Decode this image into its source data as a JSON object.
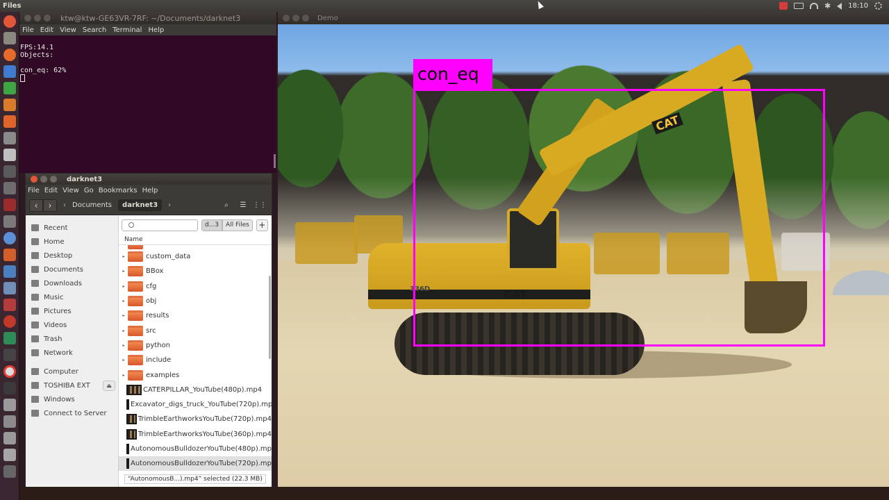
{
  "top_panel": {
    "app_name": "Files",
    "clock": "18:10"
  },
  "terminal": {
    "title": "ktw@ktw-GE63VR-7RF: ~/Documents/darknet3",
    "menu": [
      "File",
      "Edit",
      "View",
      "Search",
      "Terminal",
      "Help"
    ],
    "lines": [
      "FPS:14.1",
      "Objects:",
      "",
      "con_eq: 62%"
    ]
  },
  "file_manager": {
    "title": "darknet3",
    "menu": [
      "File",
      "Edit",
      "View",
      "Go",
      "Bookmarks",
      "Help"
    ],
    "breadcrumbs": [
      "Documents",
      "darknet3"
    ],
    "sidebar": {
      "places": [
        "Recent",
        "Home",
        "Desktop",
        "Documents",
        "Downloads",
        "Music",
        "Pictures",
        "Videos",
        "Trash",
        "Network"
      ],
      "devices": [
        "Computer",
        "TOSHIBA EXT",
        "Windows",
        "Connect to Server"
      ]
    },
    "search": {
      "scope_current": "d...3",
      "scope_all": "All Files",
      "add_label": "+"
    },
    "column_header": "Name",
    "folders": [
      "custom_data",
      "BBox",
      "cfg",
      "obj",
      "results",
      "src",
      "python",
      "include",
      "examples"
    ],
    "videos": [
      "CATERPILLAR_YouTube(480p).mp4",
      "Excavator_digs_truck_YouTube(720p).mp4",
      "TrimbleEarthworksYouTube(720p).mp4",
      "TrimbleEarthworksYouTube(360p).mp4",
      "AutonomousBulldozerYouTube(480p).mp4",
      "AutonomousBulldozerYouTube(720p).mp4"
    ],
    "selected_file": "AutonomousBulldozerYouTube(720p).mp4",
    "status": "“AutonomousB...).mp4” selected  (22.3 MB)"
  },
  "demo": {
    "title": "Demo",
    "detection_label": "con_eq",
    "detection_color": "#ff00ff",
    "machine_text_1": "CAT",
    "machine_text_2": "CAT",
    "machine_text_3": "336D"
  }
}
